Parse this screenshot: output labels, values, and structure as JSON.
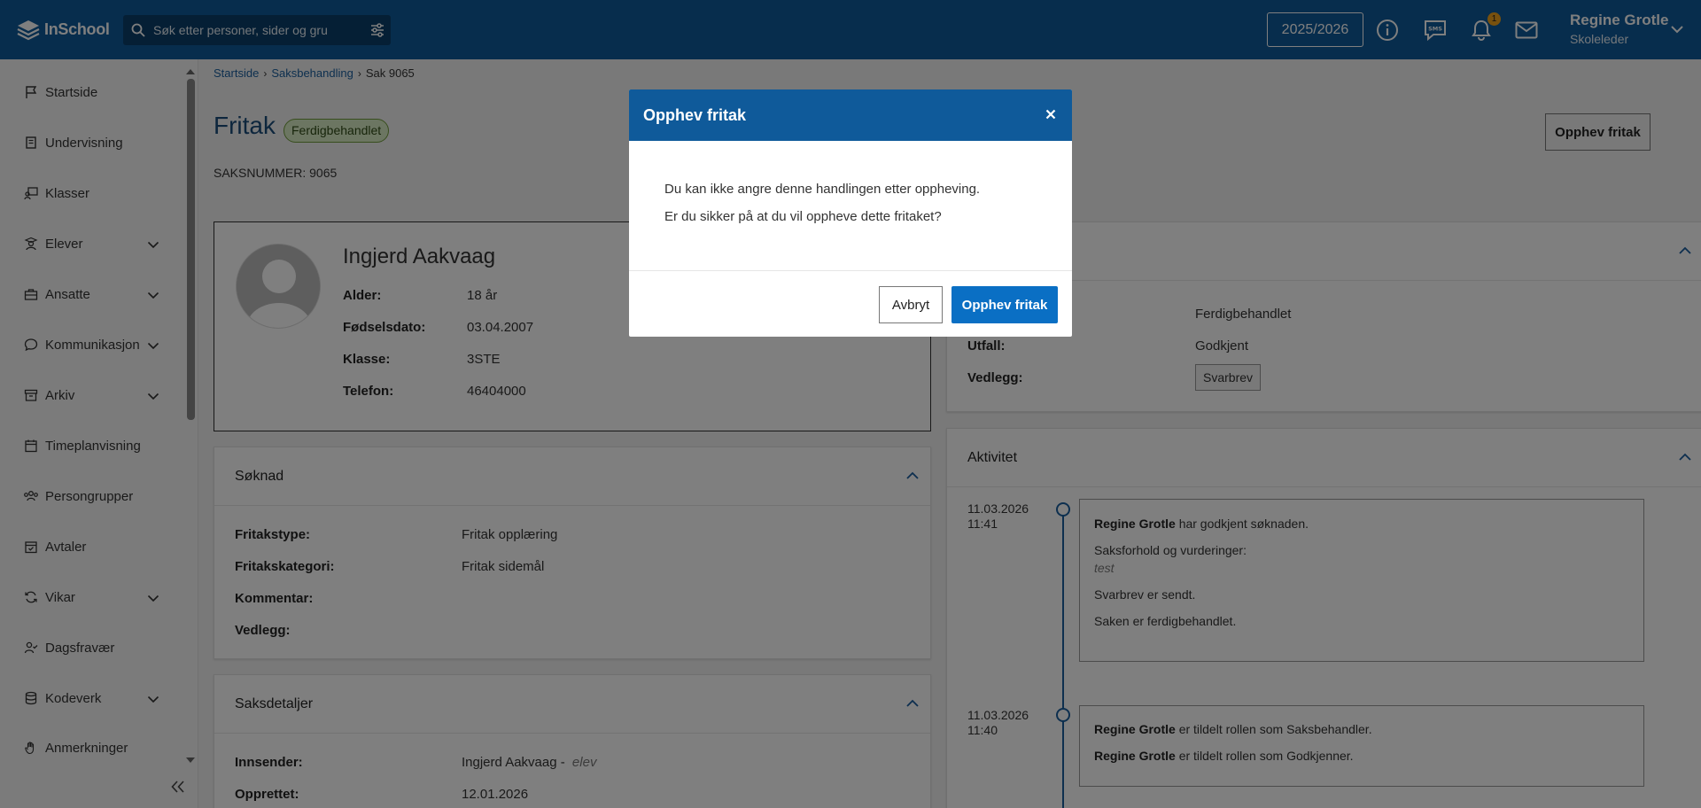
{
  "topbar": {
    "brand": "InSchool",
    "search_placeholder": "Søk etter personer, sider og gru",
    "school_year": "2025/2026",
    "notification_count": "1",
    "user_name": "Regine Grotle",
    "user_role": "Skoleleder",
    "sms_label": "SMS"
  },
  "sidebar": {
    "items": [
      {
        "label": "Startside",
        "icon": "flag-icon"
      },
      {
        "label": "Undervisning",
        "icon": "book-icon"
      },
      {
        "label": "Klasser",
        "icon": "classroom-icon"
      },
      {
        "label": "Elever",
        "icon": "student-icon"
      },
      {
        "label": "Ansatte",
        "icon": "briefcase-icon"
      },
      {
        "label": "Kommunikasjon",
        "icon": "chat-icon"
      },
      {
        "label": "Arkiv",
        "icon": "archive-icon"
      },
      {
        "label": "Timeplanvisning",
        "icon": "calendar-icon"
      },
      {
        "label": "Persongrupper",
        "icon": "group-icon"
      },
      {
        "label": "Avtaler",
        "icon": "calendar-check-icon"
      },
      {
        "label": "Vikar",
        "icon": "swap-icon"
      },
      {
        "label": "Dagsfravær",
        "icon": "user-check-icon"
      },
      {
        "label": "Kodeverk",
        "icon": "database-icon"
      },
      {
        "label": "Anmerkninger",
        "icon": "hand-icon"
      }
    ]
  },
  "breadcrumb": {
    "items": [
      "Startside",
      "Saksbehandling",
      "Sak 9065"
    ]
  },
  "page": {
    "title": "Fritak",
    "status": "Ferdigbehandlet",
    "case_number": "SAKSNUMMER: 9065",
    "action_button": "Opphev fritak"
  },
  "person": {
    "name": "Ingjerd Aakvaag",
    "fields": [
      {
        "label": "Alder:",
        "value": "18 år"
      },
      {
        "label": "Fødselsdato:",
        "value": "03.04.2007"
      },
      {
        "label": "Klasse:",
        "value": "3STE"
      },
      {
        "label": "Telefon:",
        "value": "46404000"
      }
    ]
  },
  "application": {
    "title": "Søknad",
    "fields": [
      {
        "label": "Fritakstype:",
        "value": "Fritak opplæring"
      },
      {
        "label": "Fritakskategori:",
        "value": "Fritak sidemål"
      },
      {
        "label": "Kommentar:",
        "value": ""
      },
      {
        "label": "Vedlegg:",
        "value": ""
      }
    ]
  },
  "case_details": {
    "title": "Saksdetaljer",
    "fields": [
      {
        "label": "Innsender:",
        "value": "Ingjerd Aakvaag -",
        "role": "elev"
      },
      {
        "label": "Opprettet:",
        "value": "12.01.2026"
      }
    ]
  },
  "decision": {
    "fields": [
      {
        "label": "",
        "value": "Ferdigbehandlet"
      },
      {
        "label": "Utfall:",
        "value": "Godkjent"
      },
      {
        "label": "Vedlegg:",
        "value": "Svarbrev"
      }
    ]
  },
  "activity": {
    "title": "Aktivitet",
    "entries": [
      {
        "date": "11.03.2026",
        "time": "11:41",
        "actor": "Regine Grotle",
        "line1": "har godkjent søknaden.",
        "line2": "Saksforhold og vurderinger:",
        "note": "test",
        "line3": "Svarbrev er sendt.",
        "line4": "Saken er ferdigbehandlet."
      },
      {
        "date": "11.03.2026",
        "time": "11:40",
        "actor1": "Regine Grotle",
        "line1": "er tildelt rollen som Saksbehandler.",
        "actor2": "Regine Grotle",
        "line2": "er tildelt rollen som Godkjenner."
      }
    ]
  },
  "modal": {
    "title": "Opphev fritak",
    "line1": "Du kan ikke angre denne handlingen etter oppheving.",
    "line2": "Er du sikker på at du vil oppheve dette fritaket?",
    "cancel": "Avbryt",
    "confirm": "Opphev fritak"
  },
  "colors": {
    "brand": "#0f5a9a",
    "primary_button": "#0a6fc4",
    "status_bg": "#d9ecc4",
    "notification": "#f0a31c"
  }
}
